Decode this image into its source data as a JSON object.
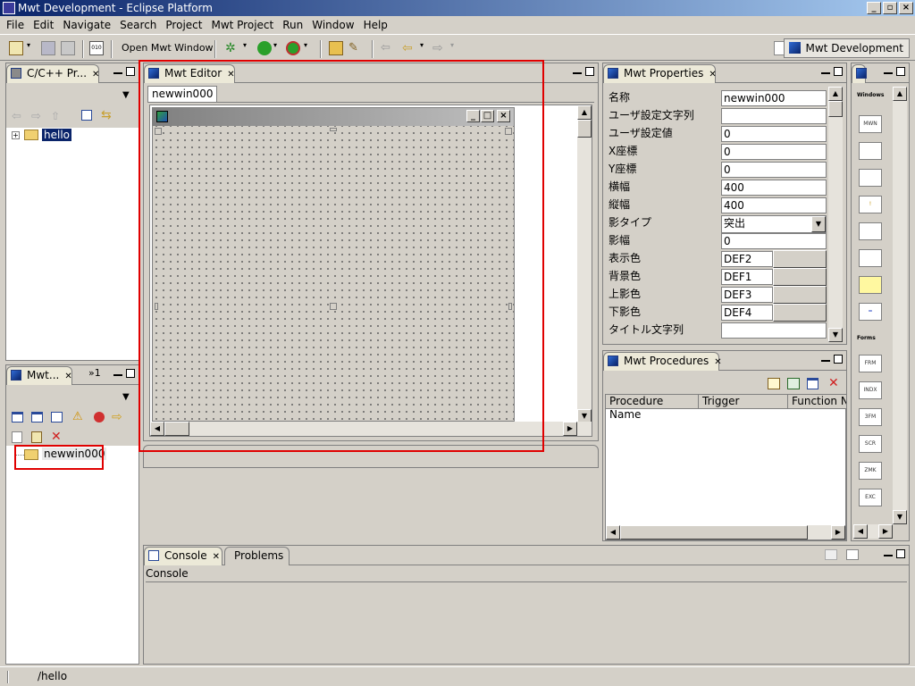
{
  "window": {
    "title": "Mwt Development - Eclipse Platform"
  },
  "menu": [
    "File",
    "Edit",
    "Navigate",
    "Search",
    "Project",
    "Mwt Project",
    "Run",
    "Window",
    "Help"
  ],
  "toolbar": {
    "open_mwt_window": "Open Mwt Window",
    "perspective": "Mwt Development"
  },
  "project_view": {
    "tab": "C/C++ Pr...",
    "tree_item": "hello"
  },
  "mwt_view": {
    "tab": "Mwt...",
    "overflow": "»1",
    "tree_item": "newwin000"
  },
  "editor": {
    "tab": "Mwt Editor",
    "subtab": "newwin000"
  },
  "properties": {
    "tab": "Mwt Properties",
    "rows": [
      {
        "label": "名称",
        "value": "newwin000"
      },
      {
        "label": "ユーザ設定文字列",
        "value": ""
      },
      {
        "label": "ユーザ設定値",
        "value": "0"
      },
      {
        "label": "X座標",
        "value": "0"
      },
      {
        "label": "Y座標",
        "value": "0"
      },
      {
        "label": "横幅",
        "value": "400"
      },
      {
        "label": "縦幅",
        "value": "400"
      },
      {
        "label": "影タイプ",
        "value": "突出"
      },
      {
        "label": "影幅",
        "value": "0"
      },
      {
        "label": "表示色",
        "value": "DEF2"
      },
      {
        "label": "背景色",
        "value": "DEF1"
      },
      {
        "label": "上影色",
        "value": "DEF3"
      },
      {
        "label": "下影色",
        "value": "DEF4"
      },
      {
        "label": "タイトル文字列",
        "value": ""
      }
    ]
  },
  "procedures": {
    "tab": "Mwt Procedures",
    "columns": [
      "Procedure Name",
      "Trigger",
      "Function Na"
    ]
  },
  "palette": {
    "section1": "Windows",
    "section2": "Forms",
    "items1": [
      "MWN",
      "",
      "",
      "!",
      "",
      "",
      "",
      "="
    ],
    "items2": [
      "FRM",
      "INDX",
      "3FM",
      "SCR",
      "ZMK",
      "EXC"
    ]
  },
  "console": {
    "tab": "Console",
    "tab2": "Problems",
    "label": "Console"
  },
  "status": {
    "path": "/hello"
  },
  "colors": {
    "highlight": "#e00000",
    "titlebar": "#0a246a"
  }
}
